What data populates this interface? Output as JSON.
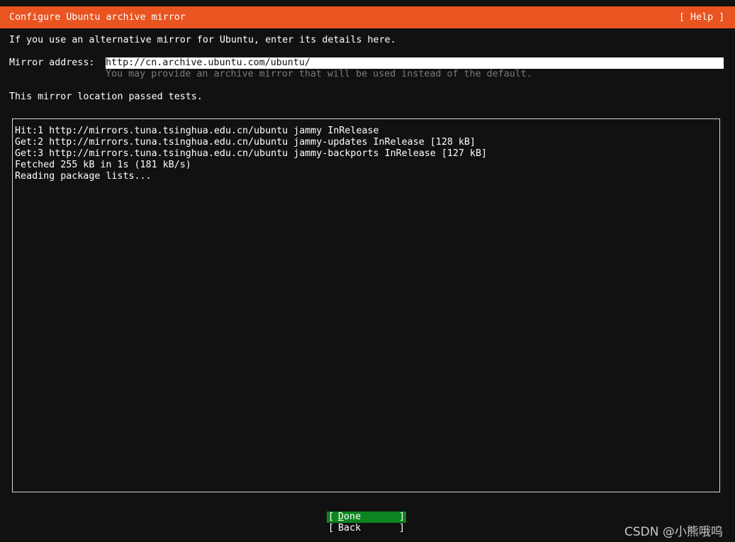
{
  "titlebar": {
    "title": "Configure Ubuntu archive mirror",
    "help_label": "[ Help ]",
    "color": "#e95420"
  },
  "intro_text": "If you use an alternative mirror for Ubuntu, enter its details here.",
  "mirror": {
    "label": "Mirror address:",
    "value": "http://cn.archive.ubuntu.com/ubuntu/",
    "hint": "You may provide an archive mirror that will be used instead of the default."
  },
  "status_text": "This mirror location passed tests.",
  "log_lines": [
    "Hit:1 http://mirrors.tuna.tsinghua.edu.cn/ubuntu jammy InRelease",
    "Get:2 http://mirrors.tuna.tsinghua.edu.cn/ubuntu jammy-updates InRelease [128 kB]",
    "Get:3 http://mirrors.tuna.tsinghua.edu.cn/ubuntu jammy-backports InRelease [127 kB]",
    "Fetched 255 kB in 1s (181 kB/s)",
    "Reading package lists..."
  ],
  "buttons": {
    "open_bracket": "[",
    "close_bracket": "]",
    "done_first": "D",
    "done_rest": "one",
    "back_label": "Back",
    "done_color": "#0e8420"
  },
  "watermark": "CSDN @小熊哦呜"
}
